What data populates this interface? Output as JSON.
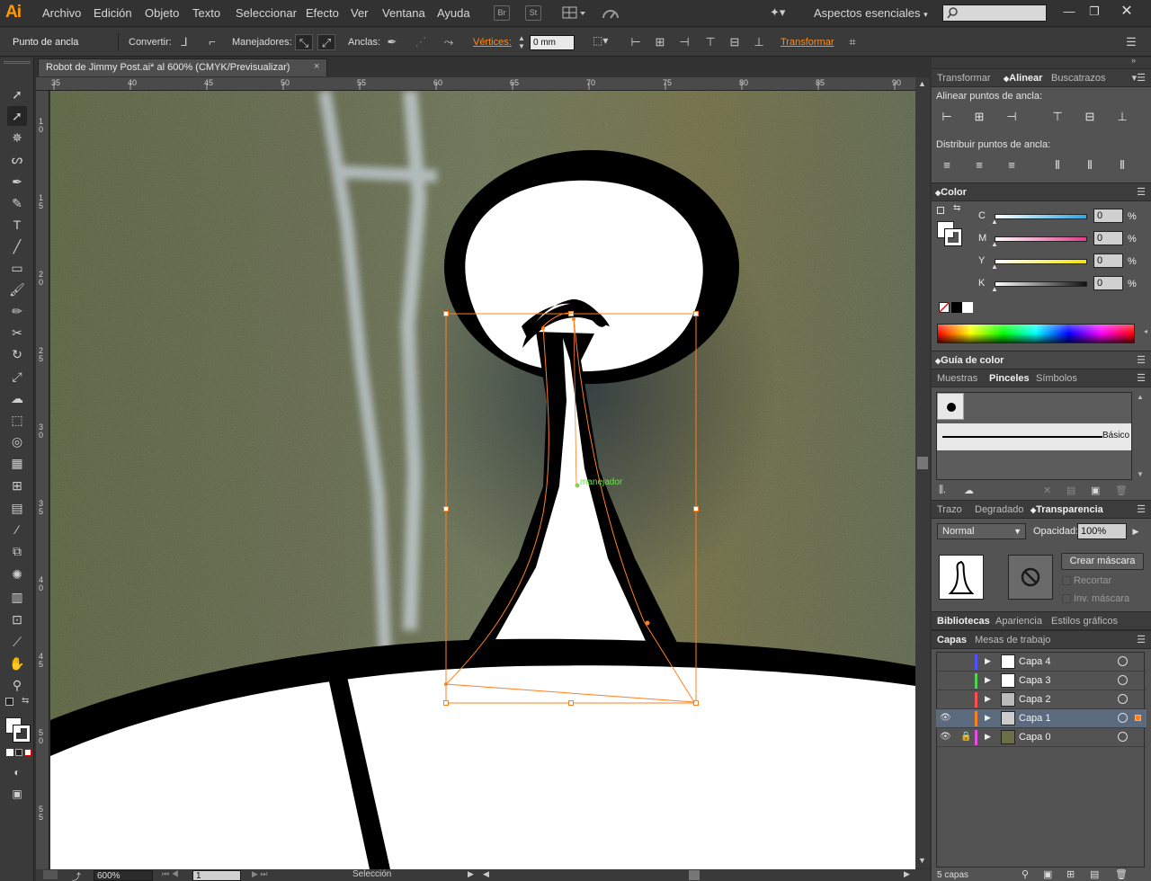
{
  "app": {
    "logo": "Ai"
  },
  "menu": [
    "Archivo",
    "Edición",
    "Objeto",
    "Texto",
    "Seleccionar",
    "Efecto",
    "Ver",
    "Ventana",
    "Ayuda"
  ],
  "menu_buttons": {
    "bridge": "Br",
    "stock": "St"
  },
  "workspace": {
    "label": "Aspectos esenciales"
  },
  "control": {
    "title": "Punto de ancla",
    "convert_label": "Convertir:",
    "handles_label": "Manejadores:",
    "anchors_label": "Anclas:",
    "vertices_label": "Vértices:",
    "vertices_value": "0 mm",
    "transform_label": "Transformar"
  },
  "document": {
    "tab_title": "Robot de Jimmy Post.ai* al 600% (CMYK/Previsualizar)",
    "close": "×"
  },
  "rulers": {
    "top": [
      "35",
      "40",
      "45",
      "50",
      "55",
      "60",
      "65",
      "70",
      "75",
      "80",
      "85",
      "90"
    ],
    "left": [
      "1 0",
      "1 5",
      "2 0",
      "2 5",
      "3 0",
      "3 5",
      "4 0",
      "4 5",
      "5 0",
      "5 5"
    ]
  },
  "canvas": {
    "smart_guide_label": "manejador"
  },
  "status": {
    "zoom": "600%",
    "page": "1",
    "tool_name": "Selección"
  },
  "align_panel": {
    "tabs": [
      "Transformar",
      "Alinear",
      "Buscatrazos"
    ],
    "align_section": "Alinear puntos de ancla:",
    "distribute_section": "Distribuir puntos de ancla:"
  },
  "color_panel": {
    "title": "Color",
    "channels": [
      {
        "label": "C",
        "value": "0",
        "unit": "%",
        "gradient": "#2aa6e0"
      },
      {
        "label": "M",
        "value": "0",
        "unit": "%",
        "gradient": "#e2398a"
      },
      {
        "label": "Y",
        "value": "0",
        "unit": "%",
        "gradient": "#f3e500"
      },
      {
        "label": "K",
        "value": "0",
        "unit": "%",
        "gradient": "#111111"
      }
    ]
  },
  "color_guide": {
    "title": "Guía de color"
  },
  "brushes_panel": {
    "tabs": [
      "Muestras",
      "Pinceles",
      "Símbolos"
    ],
    "brush_name": "Básico"
  },
  "transparency_panel": {
    "tabs": [
      "Trazo",
      "Degradado",
      "Transparencia"
    ],
    "blend_mode": "Normal",
    "opacity_label": "Opacidad:",
    "opacity_value": "100%",
    "make_mask": "Crear máscara",
    "clip": "Recortar",
    "invert_mask": "Inv. máscara"
  },
  "libraries_tabs": [
    "Bibliotecas",
    "Apariencia",
    "Estilos gráficos"
  ],
  "layers_panel": {
    "tabs": [
      "Capas",
      "Mesas de trabajo"
    ],
    "layers": [
      {
        "name": "Capa 4",
        "color": "#4f4fff",
        "visible": false,
        "locked": false,
        "selected": false
      },
      {
        "name": "Capa 3",
        "color": "#4fd44f",
        "visible": false,
        "locked": false,
        "selected": false
      },
      {
        "name": "Capa 2",
        "color": "#ff4f4f",
        "visible": false,
        "locked": false,
        "selected": false
      },
      {
        "name": "Capa 1",
        "color": "#ff7f1f",
        "visible": true,
        "locked": false,
        "selected": true
      },
      {
        "name": "Capa 0",
        "color": "#e24fe2",
        "visible": true,
        "locked": true,
        "selected": false
      }
    ],
    "count_label": "5 capas"
  }
}
